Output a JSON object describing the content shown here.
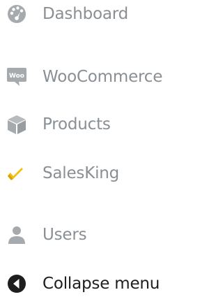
{
  "menu": {
    "items": [
      {
        "label": "Dashboard",
        "icon": "dashboard-icon"
      },
      {
        "label": "WooCommerce",
        "icon": "woocommerce-icon",
        "badge": "Woo"
      },
      {
        "label": "Products",
        "icon": "products-box-icon"
      },
      {
        "label": "SalesKing",
        "icon": "salesking-icon"
      },
      {
        "label": "Users",
        "icon": "users-icon"
      }
    ],
    "collapse": {
      "label": "Collapse menu",
      "icon": "collapse-arrow-icon"
    }
  },
  "colors": {
    "icon_gray": "#a7aaad",
    "label_gray": "#8a8f94",
    "collapse_dark": "#1e1e1e",
    "salesking_accent": "#f2c011"
  }
}
